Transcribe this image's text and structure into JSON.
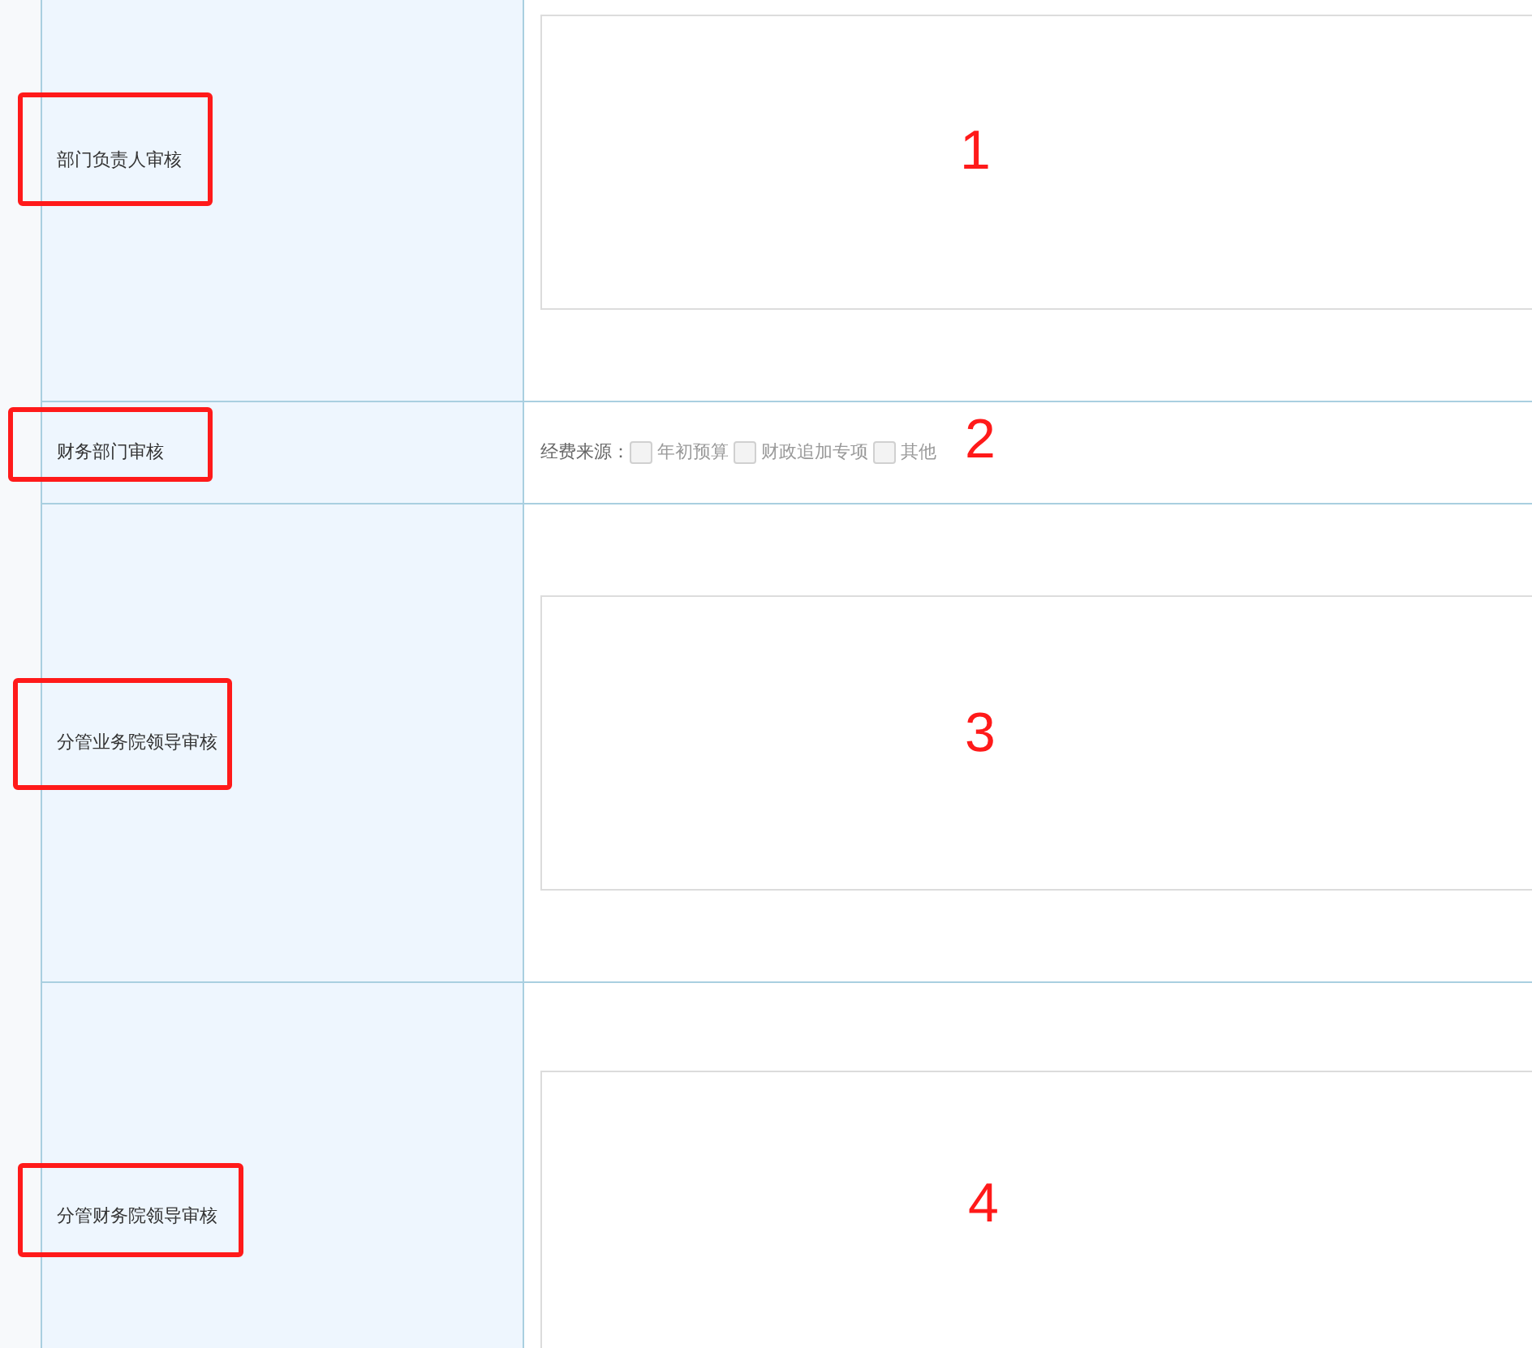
{
  "rows": [
    {
      "kind": "textarea",
      "label": "部门负责人审核"
    },
    {
      "kind": "checkboxes",
      "label": "财务部门审核",
      "prompt": "经费来源：",
      "options": [
        {
          "label": "年初预算",
          "checked": false
        },
        {
          "label": "财政追加专项",
          "checked": false
        },
        {
          "label": "其他",
          "checked": false
        }
      ]
    },
    {
      "kind": "textarea",
      "label": "分管业务院领导审核"
    },
    {
      "kind": "textarea",
      "label": "分管财务院领导审核"
    }
  ],
  "annotations": [
    {
      "label": "1"
    },
    {
      "label": "2"
    },
    {
      "label": "3"
    },
    {
      "label": "4"
    }
  ]
}
